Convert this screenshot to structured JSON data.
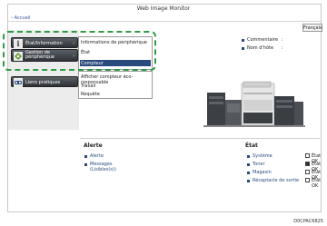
{
  "app_title": "Web Image Monitor",
  "back_link": "‹ Accueil",
  "language_button": "Français",
  "sidebar": {
    "status_info": "État/Information",
    "device_mgmt": "Gestion de\npériphérique",
    "quick_links": "Liens pratiques"
  },
  "menu_primary": {
    "items": [
      "Informations de périphérique",
      "État",
      "Compteur"
    ],
    "selected_index": 2
  },
  "menu_secondary": {
    "items": [
      "Afficher compteur éco-responsable",
      "Travail",
      "Requête"
    ]
  },
  "info": {
    "comment_label": "Commentaire",
    "host_label": "Nom d'hôte",
    "colon": ":"
  },
  "alert": {
    "title": "Alerte",
    "items": [
      "Alerte",
      "Messages",
      "(Lisibles(s))"
    ]
  },
  "status": {
    "title": "État",
    "rows": [
      {
        "label": "Système",
        "value": "État OK"
      },
      {
        "label": "Toner",
        "value": "État OK"
      },
      {
        "label": "Magasin",
        "value": "État OK"
      },
      {
        "label": "Réceptacle de sortie",
        "value": "État OK"
      }
    ]
  },
  "figure_code": "D0CPAC6825",
  "colors": {
    "accent": "#2a4a7e",
    "highlight": "#2f9b44",
    "button_dark": "#3a3e44"
  }
}
